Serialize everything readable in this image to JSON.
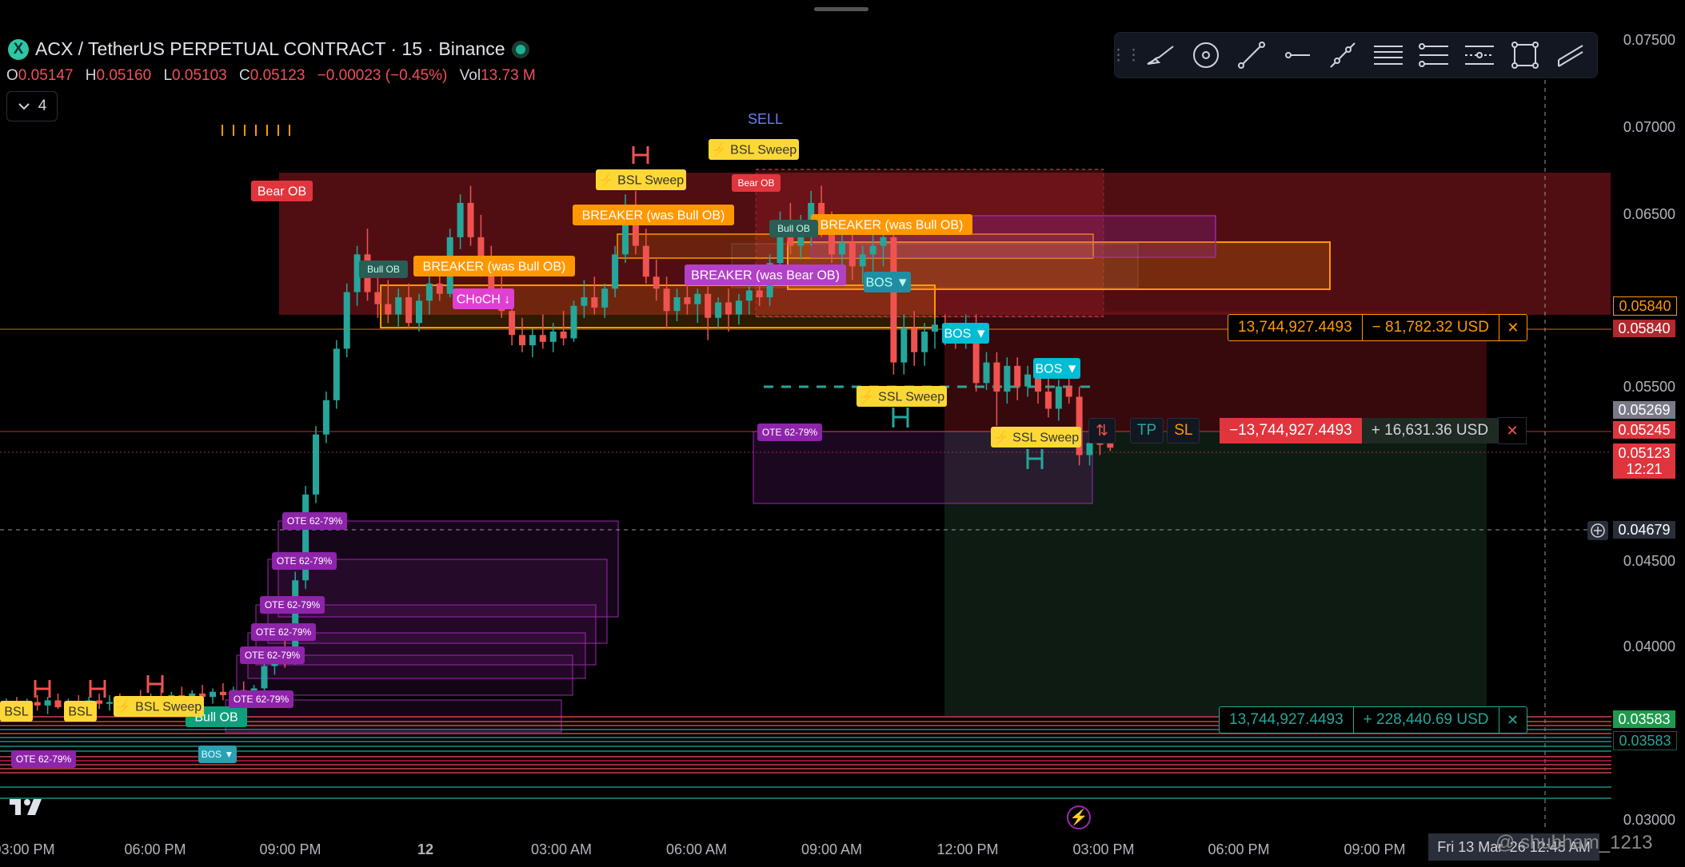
{
  "header": {
    "symbol_icon": "X",
    "title": "ACX / TetherUS PERPETUAL CONTRACT · 15 · Binance",
    "ohlc": {
      "o_label": "O",
      "o": "0.05147",
      "h_label": "H",
      "h": "0.05160",
      "l_label": "L",
      "l": "0.05103",
      "c_label": "C",
      "c": "0.05123",
      "change": "−0.00023 (−0.45%)",
      "vol_label": "Vol",
      "vol": "13.73 M"
    },
    "indicator_count": "4"
  },
  "toolbar": {
    "tools": [
      "brush-icon",
      "target-icon",
      "trend-line-icon",
      "horizontal-ray-icon",
      "extended-line-icon",
      "fib-levels-icon",
      "pitchfork-icon",
      "gann-icon",
      "rectangle-icon",
      "parallel-channel-icon"
    ]
  },
  "price_axis": {
    "labels": [
      "0.07500",
      "0.07000",
      "0.06500",
      "0.05500",
      "0.04500",
      "0.04000",
      "0.03000"
    ],
    "tags": {
      "orange": "0.05840",
      "red": "0.05840",
      "grey": "0.05269",
      "red2": "0.05245",
      "current": "0.05123",
      "countdown": "12:21",
      "crosshair": "0.04679",
      "green": "0.03583",
      "green2": "0.03583"
    }
  },
  "time_axis": {
    "labels": [
      "03:00 PM",
      "06:00 PM",
      "09:00 PM",
      "12",
      "03:00 AM",
      "06:00 AM",
      "09:00 AM",
      "12:00 PM",
      "03:00 PM",
      "06:00 PM",
      "09:00 PM"
    ],
    "crosshair_date": "Fri 13 Mar '26   12:45 AM"
  },
  "positions": {
    "top": {
      "qty": "13,744,927.4493",
      "pnl": "− 81,782.32 USD"
    },
    "entry": {
      "qty": "−13,744,927.4493",
      "pnl": "+ 16,631.36 USD"
    },
    "bottom": {
      "qty": "13,744,927.4493",
      "pnl": "+ 228,440.69 USD"
    },
    "tp": "TP",
    "sl": "SL"
  },
  "annotations": {
    "sell": "SELL",
    "bear_ob": "Bear OB",
    "bear_ob_small": "Bear OB",
    "bsl_sweep": "⚡ BSL Sweep",
    "breaker_bull": "BREAKER (was Bull OB)",
    "breaker_bear": "BREAKER (was Bear OB)",
    "choch": "CHoCH ↓",
    "bull_ob": "Bull OB",
    "bos": "BOS ▼",
    "ssl_sweep": "⚡ SSL Sweep",
    "ote": "OTE 62-79%",
    "bsl": "BSL"
  },
  "watermark": "@ shubham_1213",
  "colors": {
    "bull": "#26a69a",
    "bear": "#ef5350",
    "orange": "#ff9800",
    "purple": "#9c27b0",
    "cyan": "#00bcd4",
    "yellow": "#ffeb3b"
  },
  "chart_data": {
    "type": "candlestick",
    "title": "ACX / TetherUS PERPETUAL CONTRACT · 15 · Binance",
    "ylim": [
      0.029,
      0.0765
    ],
    "current_price": 0.05123,
    "candles": [
      {
        "o": 0.0362,
        "h": 0.0366,
        "l": 0.0356,
        "c": 0.0363
      },
      {
        "o": 0.0363,
        "h": 0.0367,
        "l": 0.0358,
        "c": 0.0361
      },
      {
        "o": 0.0361,
        "h": 0.0366,
        "l": 0.0357,
        "c": 0.0364
      },
      {
        "o": 0.0364,
        "h": 0.0368,
        "l": 0.0359,
        "c": 0.0362
      },
      {
        "o": 0.0362,
        "h": 0.0367,
        "l": 0.0357,
        "c": 0.0365
      },
      {
        "o": 0.0365,
        "h": 0.0369,
        "l": 0.036,
        "c": 0.0361
      },
      {
        "o": 0.0361,
        "h": 0.0366,
        "l": 0.0358,
        "c": 0.0364
      },
      {
        "o": 0.0364,
        "h": 0.0368,
        "l": 0.0358,
        "c": 0.0362
      },
      {
        "o": 0.0362,
        "h": 0.0367,
        "l": 0.0359,
        "c": 0.0365
      },
      {
        "o": 0.0365,
        "h": 0.0369,
        "l": 0.036,
        "c": 0.0363
      },
      {
        "o": 0.0363,
        "h": 0.0368,
        "l": 0.0359,
        "c": 0.0364
      },
      {
        "o": 0.0364,
        "h": 0.0369,
        "l": 0.036,
        "c": 0.0362
      },
      {
        "o": 0.0362,
        "h": 0.0367,
        "l": 0.0357,
        "c": 0.0366
      },
      {
        "o": 0.0366,
        "h": 0.0371,
        "l": 0.0362,
        "c": 0.0364
      },
      {
        "o": 0.0364,
        "h": 0.0369,
        "l": 0.036,
        "c": 0.0367
      },
      {
        "o": 0.0367,
        "h": 0.0372,
        "l": 0.0362,
        "c": 0.0365
      },
      {
        "o": 0.0365,
        "h": 0.037,
        "l": 0.0361,
        "c": 0.0368
      },
      {
        "o": 0.0368,
        "h": 0.0373,
        "l": 0.0363,
        "c": 0.0366
      },
      {
        "o": 0.0366,
        "h": 0.0371,
        "l": 0.0362,
        "c": 0.0369
      },
      {
        "o": 0.0369,
        "h": 0.0374,
        "l": 0.0365,
        "c": 0.0367
      },
      {
        "o": 0.0367,
        "h": 0.0372,
        "l": 0.0363,
        "c": 0.037
      },
      {
        "o": 0.037,
        "h": 0.0375,
        "l": 0.0365,
        "c": 0.0368
      },
      {
        "o": 0.0368,
        "h": 0.0373,
        "l": 0.0364,
        "c": 0.0371
      },
      {
        "o": 0.0371,
        "h": 0.0376,
        "l": 0.0366,
        "c": 0.0369
      },
      {
        "o": 0.0369,
        "h": 0.0374,
        "l": 0.0365,
        "c": 0.0372
      },
      {
        "o": 0.0372,
        "h": 0.0388,
        "l": 0.0368,
        "c": 0.0385
      },
      {
        "o": 0.0385,
        "h": 0.0395,
        "l": 0.038,
        "c": 0.039
      },
      {
        "o": 0.039,
        "h": 0.04,
        "l": 0.0384,
        "c": 0.0388
      },
      {
        "o": 0.0388,
        "h": 0.044,
        "l": 0.0386,
        "c": 0.0435
      },
      {
        "o": 0.0435,
        "h": 0.049,
        "l": 0.043,
        "c": 0.0485
      },
      {
        "o": 0.0485,
        "h": 0.0525,
        "l": 0.048,
        "c": 0.052
      },
      {
        "o": 0.052,
        "h": 0.0545,
        "l": 0.0515,
        "c": 0.054
      },
      {
        "o": 0.054,
        "h": 0.0575,
        "l": 0.0535,
        "c": 0.057
      },
      {
        "o": 0.057,
        "h": 0.0608,
        "l": 0.0565,
        "c": 0.0603
      },
      {
        "o": 0.0603,
        "h": 0.063,
        "l": 0.0595,
        "c": 0.0625
      },
      {
        "o": 0.0625,
        "h": 0.064,
        "l": 0.0598,
        "c": 0.0603
      },
      {
        "o": 0.0603,
        "h": 0.0615,
        "l": 0.0588,
        "c": 0.0596
      },
      {
        "o": 0.0596,
        "h": 0.061,
        "l": 0.0585,
        "c": 0.059
      },
      {
        "o": 0.059,
        "h": 0.0605,
        "l": 0.0583,
        "c": 0.06
      },
      {
        "o": 0.06,
        "h": 0.0608,
        "l": 0.0582,
        "c": 0.0585
      },
      {
        "o": 0.0585,
        "h": 0.0602,
        "l": 0.058,
        "c": 0.0598
      },
      {
        "o": 0.0598,
        "h": 0.0612,
        "l": 0.059,
        "c": 0.0608
      },
      {
        "o": 0.0608,
        "h": 0.062,
        "l": 0.0598,
        "c": 0.0602
      },
      {
        "o": 0.0602,
        "h": 0.064,
        "l": 0.06,
        "c": 0.0635
      },
      {
        "o": 0.0635,
        "h": 0.066,
        "l": 0.0628,
        "c": 0.0655
      },
      {
        "o": 0.0655,
        "h": 0.0665,
        "l": 0.063,
        "c": 0.0635
      },
      {
        "o": 0.0635,
        "h": 0.0648,
        "l": 0.0612,
        "c": 0.0618
      },
      {
        "o": 0.0618,
        "h": 0.063,
        "l": 0.06,
        "c": 0.0605
      },
      {
        "o": 0.0605,
        "h": 0.0612,
        "l": 0.0588,
        "c": 0.0592
      },
      {
        "o": 0.0592,
        "h": 0.06,
        "l": 0.0572,
        "c": 0.0578
      },
      {
        "o": 0.0578,
        "h": 0.0588,
        "l": 0.0568,
        "c": 0.0572
      },
      {
        "o": 0.0572,
        "h": 0.0582,
        "l": 0.0565,
        "c": 0.0578
      },
      {
        "o": 0.0578,
        "h": 0.059,
        "l": 0.057,
        "c": 0.0574
      },
      {
        "o": 0.0574,
        "h": 0.0585,
        "l": 0.0568,
        "c": 0.058
      },
      {
        "o": 0.058,
        "h": 0.0592,
        "l": 0.0572,
        "c": 0.0576
      },
      {
        "o": 0.0576,
        "h": 0.0598,
        "l": 0.0574,
        "c": 0.0595
      },
      {
        "o": 0.0595,
        "h": 0.061,
        "l": 0.0588,
        "c": 0.06
      },
      {
        "o": 0.06,
        "h": 0.0612,
        "l": 0.059,
        "c": 0.0594
      },
      {
        "o": 0.0594,
        "h": 0.0608,
        "l": 0.0588,
        "c": 0.0605
      },
      {
        "o": 0.0605,
        "h": 0.063,
        "l": 0.06,
        "c": 0.0625
      },
      {
        "o": 0.0625,
        "h": 0.066,
        "l": 0.062,
        "c": 0.0652
      },
      {
        "o": 0.0652,
        "h": 0.0662,
        "l": 0.0625,
        "c": 0.063
      },
      {
        "o": 0.063,
        "h": 0.064,
        "l": 0.0608,
        "c": 0.0612
      },
      {
        "o": 0.0612,
        "h": 0.0622,
        "l": 0.0598,
        "c": 0.0605
      },
      {
        "o": 0.0605,
        "h": 0.0612,
        "l": 0.0582,
        "c": 0.0592
      },
      {
        "o": 0.0592,
        "h": 0.0605,
        "l": 0.0586,
        "c": 0.06
      },
      {
        "o": 0.06,
        "h": 0.0612,
        "l": 0.059,
        "c": 0.0596
      },
      {
        "o": 0.0596,
        "h": 0.0605,
        "l": 0.0585,
        "c": 0.0602
      },
      {
        "o": 0.0602,
        "h": 0.0608,
        "l": 0.0575,
        "c": 0.0588
      },
      {
        "o": 0.0588,
        "h": 0.06,
        "l": 0.0582,
        "c": 0.0597
      },
      {
        "o": 0.0597,
        "h": 0.0605,
        "l": 0.058,
        "c": 0.059
      },
      {
        "o": 0.059,
        "h": 0.0602,
        "l": 0.0584,
        "c": 0.0598
      },
      {
        "o": 0.0598,
        "h": 0.061,
        "l": 0.059,
        "c": 0.0604
      },
      {
        "o": 0.0604,
        "h": 0.0615,
        "l": 0.0595,
        "c": 0.06
      },
      {
        "o": 0.06,
        "h": 0.0625,
        "l": 0.0595,
        "c": 0.062
      },
      {
        "o": 0.062,
        "h": 0.065,
        "l": 0.0615,
        "c": 0.0645
      },
      {
        "o": 0.0645,
        "h": 0.0655,
        "l": 0.0625,
        "c": 0.063
      },
      {
        "o": 0.063,
        "h": 0.0648,
        "l": 0.0622,
        "c": 0.064
      },
      {
        "o": 0.064,
        "h": 0.0662,
        "l": 0.063,
        "c": 0.0655
      },
      {
        "o": 0.0655,
        "h": 0.0665,
        "l": 0.0635,
        "c": 0.064
      },
      {
        "o": 0.064,
        "h": 0.065,
        "l": 0.062,
        "c": 0.0625
      },
      {
        "o": 0.0625,
        "h": 0.064,
        "l": 0.0615,
        "c": 0.0632
      },
      {
        "o": 0.0632,
        "h": 0.0642,
        "l": 0.061,
        "c": 0.0618
      },
      {
        "o": 0.0618,
        "h": 0.063,
        "l": 0.0608,
        "c": 0.0625
      },
      {
        "o": 0.0625,
        "h": 0.0638,
        "l": 0.0615,
        "c": 0.063
      },
      {
        "o": 0.063,
        "h": 0.064,
        "l": 0.0618,
        "c": 0.0635
      },
      {
        "o": 0.0635,
        "h": 0.064,
        "l": 0.0555,
        "c": 0.0562
      },
      {
        "o": 0.0562,
        "h": 0.059,
        "l": 0.0555,
        "c": 0.0582
      },
      {
        "o": 0.0582,
        "h": 0.0592,
        "l": 0.056,
        "c": 0.0568
      },
      {
        "o": 0.0568,
        "h": 0.0585,
        "l": 0.056,
        "c": 0.058
      },
      {
        "o": 0.058,
        "h": 0.0588,
        "l": 0.057,
        "c": 0.0584
      },
      {
        "o": 0.0584,
        "h": 0.059,
        "l": 0.0572,
        "c": 0.0578
      },
      {
        "o": 0.0578,
        "h": 0.0585,
        "l": 0.057,
        "c": 0.0575
      },
      {
        "o": 0.0575,
        "h": 0.059,
        "l": 0.057,
        "c": 0.0585
      },
      {
        "o": 0.0585,
        "h": 0.059,
        "l": 0.0545,
        "c": 0.055
      },
      {
        "o": 0.055,
        "h": 0.0568,
        "l": 0.0546,
        "c": 0.0562
      },
      {
        "o": 0.0562,
        "h": 0.0568,
        "l": 0.0525,
        "c": 0.0545
      },
      {
        "o": 0.0545,
        "h": 0.0565,
        "l": 0.0538,
        "c": 0.056
      },
      {
        "o": 0.056,
        "h": 0.0565,
        "l": 0.054,
        "c": 0.0548
      },
      {
        "o": 0.0548,
        "h": 0.056,
        "l": 0.0542,
        "c": 0.0555
      },
      {
        "o": 0.0555,
        "h": 0.0562,
        "l": 0.0538,
        "c": 0.0545
      },
      {
        "o": 0.0545,
        "h": 0.0555,
        "l": 0.053,
        "c": 0.0535
      },
      {
        "o": 0.0535,
        "h": 0.0552,
        "l": 0.0528,
        "c": 0.0548
      },
      {
        "o": 0.0548,
        "h": 0.056,
        "l": 0.0538,
        "c": 0.0542
      },
      {
        "o": 0.0542,
        "h": 0.0548,
        "l": 0.0502,
        "c": 0.0508
      },
      {
        "o": 0.0508,
        "h": 0.052,
        "l": 0.0502,
        "c": 0.0515
      },
      {
        "o": 0.0515,
        "h": 0.0522,
        "l": 0.0508,
        "c": 0.0514
      },
      {
        "o": 0.05147,
        "h": 0.0516,
        "l": 0.05103,
        "c": 0.05123
      }
    ]
  }
}
